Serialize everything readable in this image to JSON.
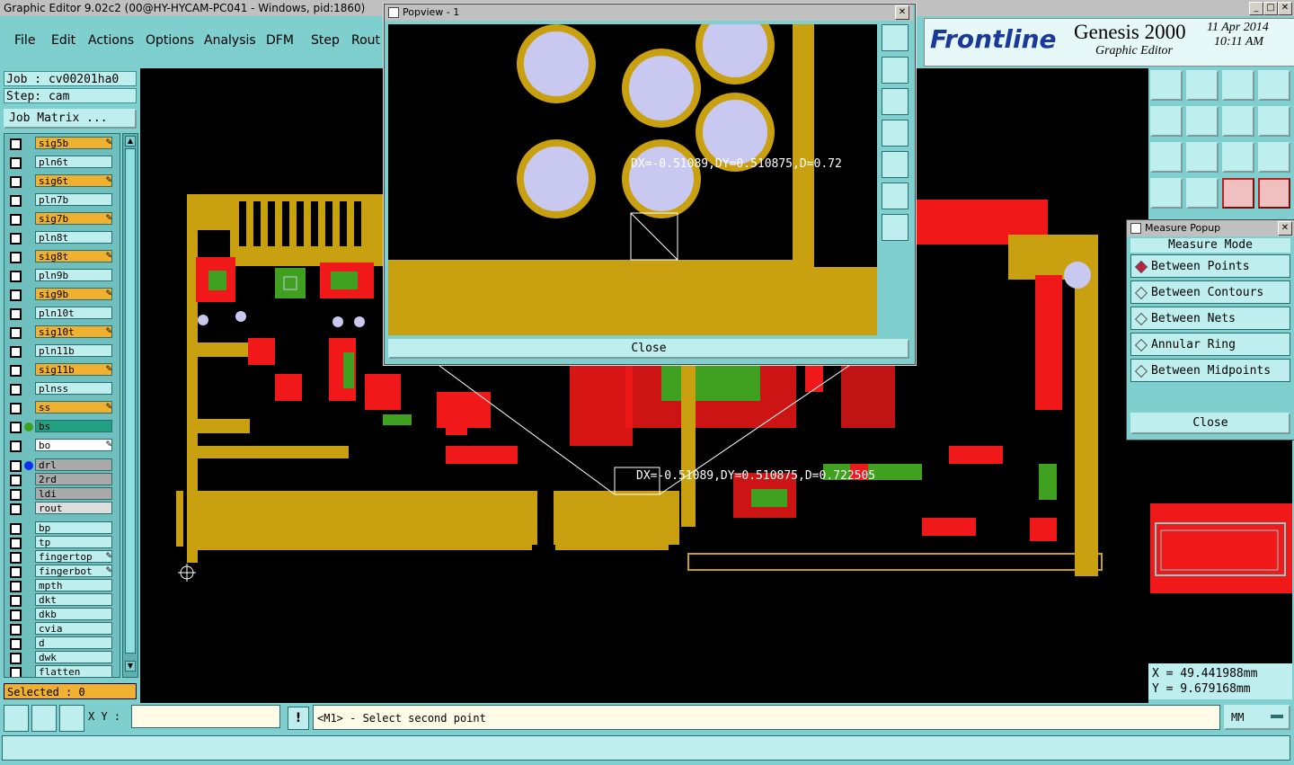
{
  "window": {
    "title": "Graphic Editor 9.02c2 (00@HY-HYCAM-PC041 - Windows, pid:1860)",
    "min": "_",
    "max": "□",
    "close": "✕"
  },
  "menu": [
    {
      "label": "File"
    },
    {
      "label": "Edit"
    },
    {
      "label": "Actions"
    },
    {
      "label": "Options"
    },
    {
      "label": "Analysis"
    },
    {
      "label": "DFM"
    },
    {
      "label": "Step"
    },
    {
      "label": "Rout"
    }
  ],
  "job": {
    "job": "Job : cv00201ha0",
    "step": "Step: cam",
    "matrix": "Job Matrix ..."
  },
  "layers": [
    {
      "name": "sig5b",
      "type": "sig"
    },
    {
      "name": "pln6t",
      "type": "pln"
    },
    {
      "name": "sig6t",
      "type": "sig"
    },
    {
      "name": "pln7b",
      "type": "pln"
    },
    {
      "name": "sig7b",
      "type": "sig"
    },
    {
      "name": "pln8t",
      "type": "pln"
    },
    {
      "name": "sig8t",
      "type": "sig"
    },
    {
      "name": "pln9b",
      "type": "pln"
    },
    {
      "name": "sig9b",
      "type": "sig"
    },
    {
      "name": "pln10t",
      "type": "pln"
    },
    {
      "name": "sig10t",
      "type": "sig"
    },
    {
      "name": "pln11b",
      "type": "pln"
    },
    {
      "name": "sig11b",
      "type": "sig"
    },
    {
      "name": "plnss",
      "type": "pln"
    },
    {
      "name": "ss",
      "type": "sig"
    },
    {
      "name": "bs",
      "type": "bs"
    },
    {
      "name": "bo",
      "type": "bo"
    },
    {
      "name": "drl",
      "type": "drl"
    },
    {
      "name": "2rd",
      "type": "drl"
    },
    {
      "name": "ldi",
      "type": "drl"
    },
    {
      "name": "rout",
      "type": "rout"
    },
    {
      "name": "bp",
      "type": "pln"
    },
    {
      "name": "tp",
      "type": "pln"
    },
    {
      "name": "fingertop",
      "type": "pln"
    },
    {
      "name": "fingerbot",
      "type": "pln"
    },
    {
      "name": "mpth",
      "type": "pln"
    },
    {
      "name": "dkt",
      "type": "pln"
    },
    {
      "name": "dkb",
      "type": "pln"
    },
    {
      "name": "cvia",
      "type": "pln"
    },
    {
      "name": "d",
      "type": "pln"
    },
    {
      "name": "dwk",
      "type": "pln"
    },
    {
      "name": "flatten",
      "type": "pln"
    }
  ],
  "selected": "Selected : 0",
  "popview": {
    "title": "Popview - 1",
    "readout": "DX=-0.51089,DY=0.510875,D=0.72",
    "close": "Close"
  },
  "canvas_readout": "DX=-0.51089,DY=0.510875,D=0.722505",
  "brand": {
    "logo": "Frontline",
    "product": "Genesis 2000",
    "subtitle": "Graphic Editor",
    "date": "11 Apr 2014",
    "time": "10:11 AM"
  },
  "measure": {
    "title": "Measure Popup",
    "mode_label": "Measure Mode",
    "options": [
      "Between Points",
      "Between Contours",
      "Between Nets",
      "Annular Ring",
      "Between Midpoints"
    ],
    "selected": 0,
    "close": "Close"
  },
  "coords": {
    "x": "X = 49.441988mm",
    "y": "Y = 9.679168mm"
  },
  "bottom": {
    "xy_label": "X Y :",
    "xy_value": "",
    "prompt": "<M1> - Select second point",
    "units": "MM",
    "bang": "!"
  },
  "colors": {
    "copper": "#c8a010",
    "red": "#f01818",
    "green": "#40a020",
    "pad": "#c8c8f0",
    "panel": "#7fcfcf",
    "field": "#bfeeee",
    "sig": "#f0b030"
  }
}
